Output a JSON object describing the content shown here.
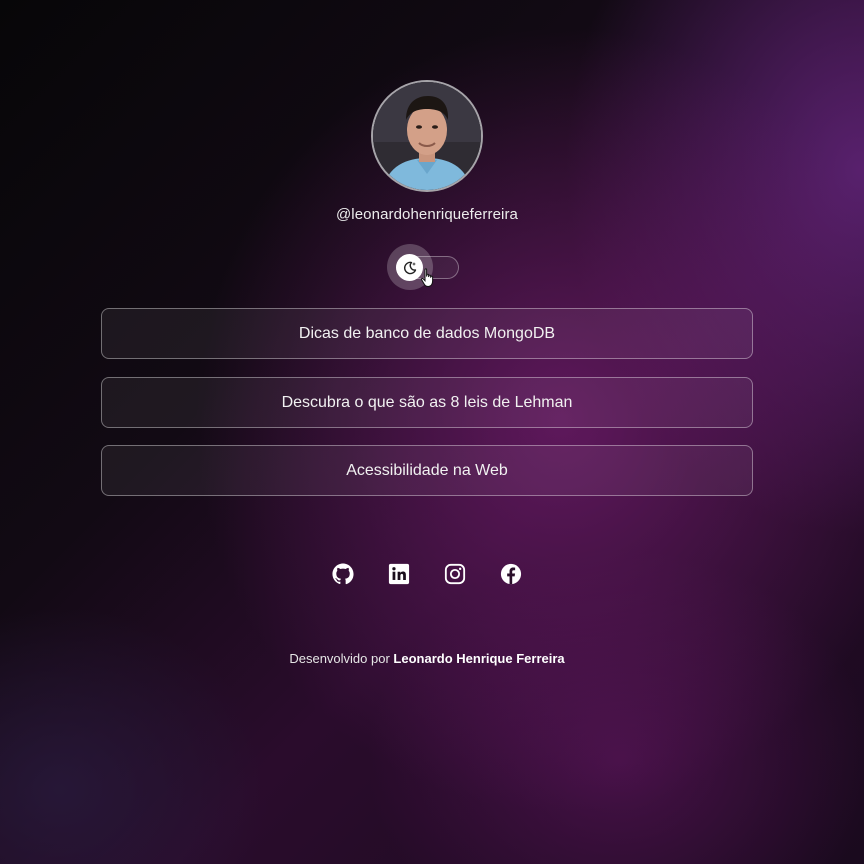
{
  "profile": {
    "username": "@leonardohenriqueferreira",
    "avatar_alt": "avatar"
  },
  "theme_toggle": {
    "state": "dark",
    "icon": "moon-stars-icon"
  },
  "links": [
    {
      "label": "Dicas de banco de dados MongoDB"
    },
    {
      "label": "Descubra o que são as 8 leis de Lehman"
    },
    {
      "label": "Acessibilidade na Web"
    }
  ],
  "social": [
    {
      "icon": "github-icon"
    },
    {
      "icon": "linkedin-icon"
    },
    {
      "icon": "instagram-icon"
    },
    {
      "icon": "facebook-icon"
    }
  ],
  "footer": {
    "prefix": "Desenvolvido por",
    "author": "Leonardo Henrique Ferreira"
  },
  "colors": {
    "background_dark": "#0d080f",
    "background_purple": "#701c6c",
    "button_border": "#ffffff"
  }
}
